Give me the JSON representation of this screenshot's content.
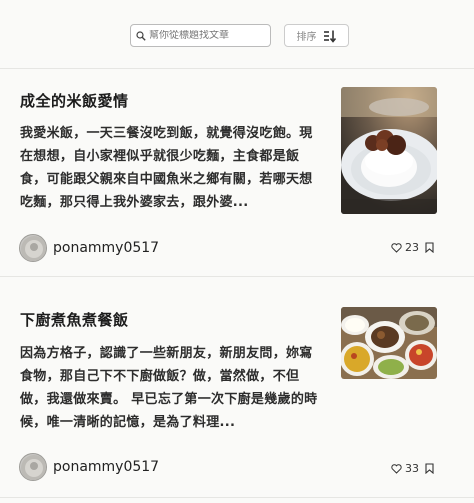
{
  "search": {
    "placeholder": "幫你從標題找文章",
    "value": ""
  },
  "sort": {
    "label": "排序"
  },
  "articles": [
    {
      "title": "成全的米飯愛情",
      "excerpt": "我愛米飯，一天三餐沒吃到飯，就覺得沒吃飽。現在想想，自小家裡似乎就很少吃麵，主食都是飯食，可能跟父親來自中國魚米之鄉有關，若哪天想吃麵，那只得上我外婆家去，跟外婆...",
      "author": "ponammy0517",
      "likes": "23"
    },
    {
      "title": "下廚煮魚煮餐飯",
      "excerpt": "因為方格子，認識了一些新朋友，新朋友問，妳寫食物，那自己下不下廚做飯？做，當然做，不但做，我還做來賣。 早已忘了第一次下廚是幾歲的時候，唯一清晰的記憶，是為了料理...",
      "author": "ponammy0517",
      "likes": "33"
    }
  ]
}
